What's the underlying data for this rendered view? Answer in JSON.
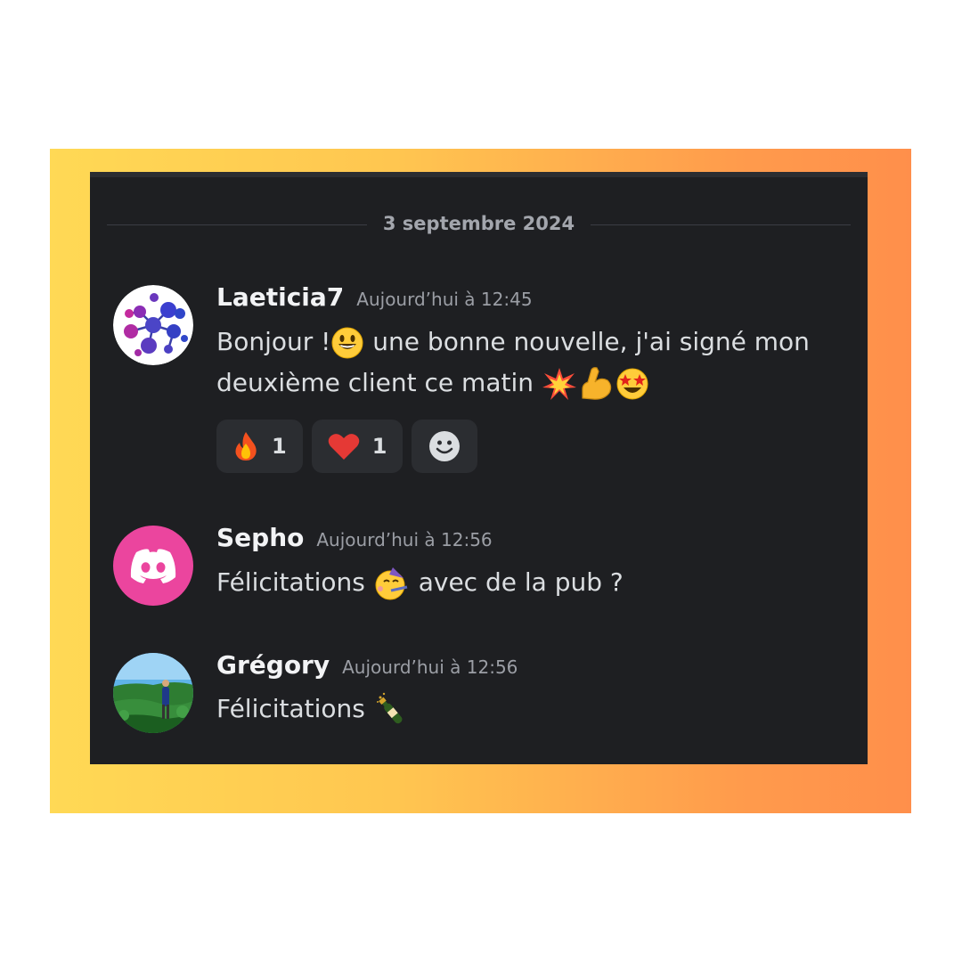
{
  "date_divider": "3 septembre 2024",
  "messages": [
    {
      "author": "Laeticia7",
      "timestamp": "Aujourd’hui à 12:45",
      "line1": "Bonjour !",
      "line1b": "une bonne nouvelle, j'ai signé mon",
      "line2": "deuxième client ce matin",
      "reactions": [
        {
          "icon": "fire-icon",
          "count": "1"
        },
        {
          "icon": "heart-icon",
          "count": "1"
        },
        {
          "icon": "add-reaction-icon"
        }
      ]
    },
    {
      "author": "Sepho",
      "timestamp": "Aujourd’hui à 12:56",
      "text_a": "Félicitations",
      "text_b": "avec de la pub ?"
    },
    {
      "author": "Grégory",
      "timestamp": "Aujourd’hui à 12:56",
      "text_a": "Félicitations"
    }
  ],
  "colors": {
    "chat_background": "#1e1f22",
    "reaction_background": "#2b2d31",
    "discord_avatar": "#eb459e",
    "gradient_start": "#ffd955",
    "gradient_end": "#ff8f4b"
  }
}
